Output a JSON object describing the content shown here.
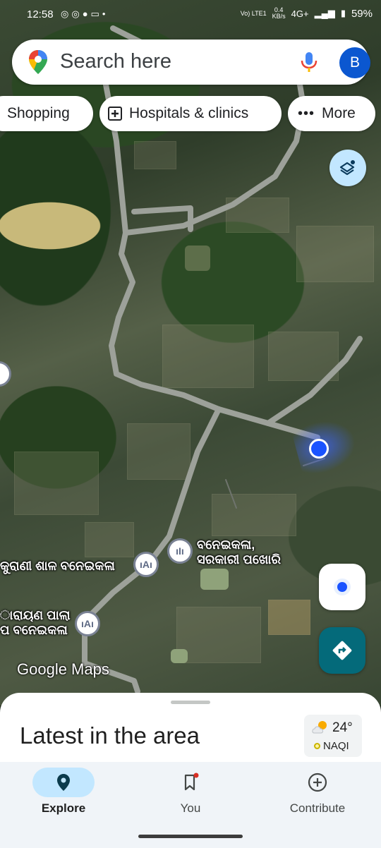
{
  "status_bar": {
    "time": "12:58",
    "left_icons": [
      "whatsapp-icon",
      "whatsapp-icon",
      "chat-icon",
      "vivo-icon",
      "dot-icon"
    ],
    "network_speed": "0.4",
    "speed_unit": "KB/s",
    "network_type": "4G+",
    "volte": "Vo) LTE1",
    "battery": "59%"
  },
  "search": {
    "placeholder": "Search here",
    "avatar_letter": "B"
  },
  "chips": [
    {
      "label": "Shopping",
      "icon": ""
    },
    {
      "label": "Hospitals & clinics",
      "icon": "hospital-icon"
    },
    {
      "label": "More",
      "icon": "more-dots-icon"
    }
  ],
  "map": {
    "labels": {
      "place_1_line1": "ବନେଇକଳା,",
      "place_1_line2": "ସରକାରୀ ପଖୋରି",
      "place_2": "କୁରାଣୀ ଶାଳ ବନେଇକଳା",
      "place_3_line1": "ାରାୟଣ ପାଲା",
      "place_3_line2": "ପ ବନେଇକଳା"
    },
    "watermark": "Google Maps"
  },
  "sheet": {
    "title": "Latest in the area",
    "weather": {
      "temp": "24°",
      "aqi": "NAQI"
    }
  },
  "nav": [
    {
      "label": "Explore",
      "icon": "explore-pin-icon",
      "active": true
    },
    {
      "label": "You",
      "icon": "bookmark-icon",
      "active": false
    },
    {
      "label": "Contribute",
      "icon": "add-circle-icon",
      "active": false
    }
  ],
  "colors": {
    "accent": "#0b57d0",
    "nav_active": "#c2e7ff",
    "directions": "#046a7a"
  }
}
